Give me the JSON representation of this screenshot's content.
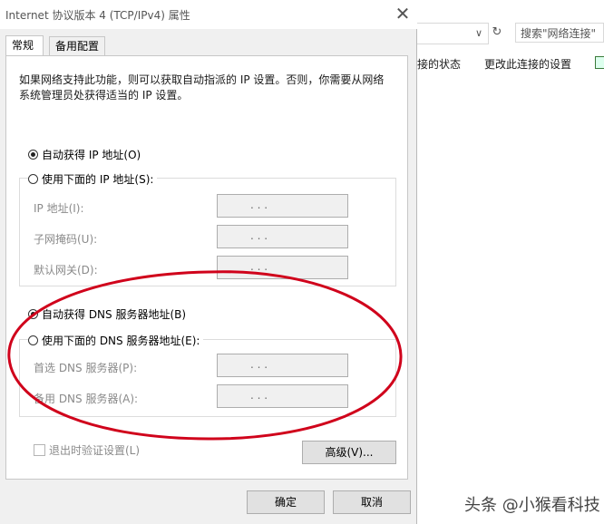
{
  "background_window": {
    "search_placeholder": "搜索\"网络连接\"",
    "refresh_glyph": "↻",
    "chevron_glyph": "∨",
    "command_left": "接的状态",
    "command_right": "更改此连接的设置"
  },
  "dialog": {
    "title": "Internet 协议版本 4 (TCP/IPv4) 属性",
    "close_glyph": "✕",
    "tabs": [
      {
        "label": "常规",
        "active": true
      },
      {
        "label": "备用配置",
        "active": false
      }
    ],
    "intro_text": "如果网络支持此功能，则可以获取自动指派的 IP 设置。否则，你需要从网络系统管理员处获得适当的 IP 设置。",
    "ip_section": {
      "auto_label": "自动获得 IP 地址(O)",
      "auto_selected": true,
      "manual_label": "使用下面的 IP 地址(S):",
      "manual_selected": false,
      "fields": [
        {
          "label": "IP 地址(I):",
          "value": ". . ."
        },
        {
          "label": "子网掩码(U):",
          "value": ". . ."
        },
        {
          "label": "默认网关(D):",
          "value": ". . ."
        }
      ]
    },
    "dns_section": {
      "auto_label": "自动获得 DNS 服务器地址(B)",
      "auto_selected": true,
      "manual_label": "使用下面的 DNS 服务器地址(E):",
      "manual_selected": false,
      "fields": [
        {
          "label": "首选 DNS 服务器(P):",
          "value": ". . ."
        },
        {
          "label": "备用 DNS 服务器(A):",
          "value": ". . ."
        }
      ]
    },
    "validate_label": "退出时验证设置(L)",
    "validate_checked": false,
    "advanced_button": "高级(V)...",
    "ok_button": "确定",
    "cancel_button": "取消"
  },
  "annotation": {
    "color": "#d0021b"
  },
  "watermark": "头条 @小猴看科技"
}
